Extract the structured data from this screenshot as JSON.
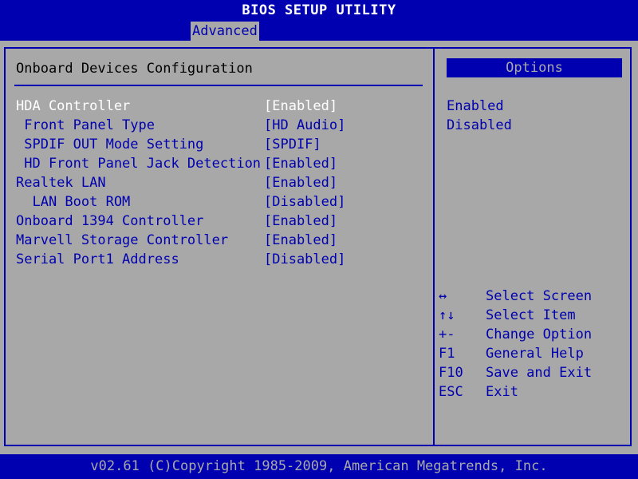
{
  "title": "BIOS SETUP UTILITY",
  "tabs": {
    "active": "Advanced"
  },
  "section": {
    "title": "Onboard Devices Configuration"
  },
  "settings": [
    {
      "label": "HDA Controller",
      "value": "[Enabled]"
    },
    {
      "label": " Front Panel Type",
      "value": "[HD Audio]"
    },
    {
      "label": " SPDIF OUT Mode Setting",
      "value": "[SPDIF]"
    },
    {
      "label": " HD Front Panel Jack Detection",
      "value": "[Enabled]"
    },
    {
      "label": "Realtek LAN",
      "value": "[Enabled]"
    },
    {
      "label": "  LAN Boot ROM",
      "value": "[Disabled]"
    },
    {
      "label": "Onboard 1394 Controller",
      "value": "[Enabled]"
    },
    {
      "label": "Marvell Storage Controller",
      "value": "[Enabled]"
    },
    {
      "label": "Serial Port1 Address",
      "value": "[Disabled]"
    }
  ],
  "options": {
    "header": "Options",
    "items": [
      "Enabled",
      "Disabled"
    ]
  },
  "help": [
    {
      "key": "↔",
      "desc": "Select Screen"
    },
    {
      "key": "↑↓",
      "desc": "Select Item"
    },
    {
      "key": "+-",
      "desc": "Change Option"
    },
    {
      "key": "F1",
      "desc": "General Help"
    },
    {
      "key": "F10",
      "desc": "Save and Exit"
    },
    {
      "key": "ESC",
      "desc": "Exit"
    }
  ],
  "footer": "v02.61 (C)Copyright 1985-2009, American Megatrends, Inc.",
  "colors": {
    "background": "#a8a8a8",
    "accent": "#0000b0",
    "highlight_text": "#ffffff"
  }
}
